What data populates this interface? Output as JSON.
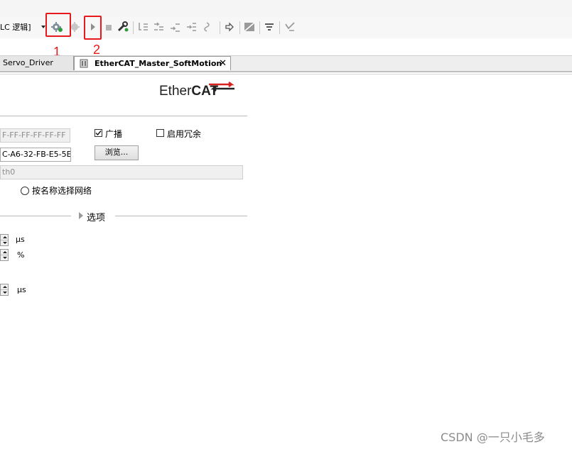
{
  "toolbar": {
    "app_combo_text": "LC 逻辑]",
    "highlight_1_number": "1",
    "highlight_2_number": "2"
  },
  "tabs": [
    {
      "label": "Servo_Driver",
      "active": false
    },
    {
      "label": "EtherCAT_Master_SoftMotion",
      "active": true
    }
  ],
  "ethercat_logo": {
    "part1": "Ether",
    "part2": "CAT"
  },
  "form": {
    "destination_mac": "F-FF-FF-FF-FF-FF",
    "broadcast_label": "广播",
    "broadcast_checked": true,
    "redundancy_label": "启用冗余",
    "redundancy_checked": false,
    "source_mac": "C-A6-32-FB-E5-5E",
    "browse_label": "浏览...",
    "network_name": "th0",
    "select_by_name_label": "按名称选择网络",
    "options_label": "选项",
    "units": [
      "μs",
      "%",
      "μs"
    ]
  },
  "watermark": "CSDN @一只小毛多",
  "colors": {
    "highlight": "#e8191c",
    "ethercat_red": "#d6231e"
  }
}
